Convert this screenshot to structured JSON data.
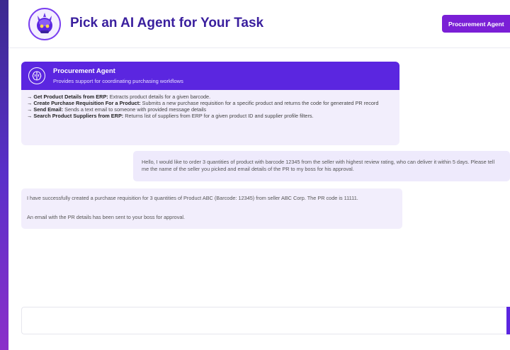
{
  "header": {
    "title": "Pick an AI Agent for Your Task",
    "agent_button_label": "Procurement Agent"
  },
  "agent_card": {
    "name": "Procurement Agent",
    "description": "Provides support for coordinating purchasing workflows",
    "tools": [
      {
        "name": "→ Get Product Details from ERP:",
        "desc": " Extracts product details for a given barcode."
      },
      {
        "name": "→ Create Purchase Requisition For a Product:",
        "desc": " Submits a new purchase requisition for a specific product and returns the code for generated PR record"
      },
      {
        "name": "→ Send Email:",
        "desc": " Sends a text email to someone with provided message details"
      },
      {
        "name": "→ Search Product Suppliers from ERP:",
        "desc": " Returns list of suppliers from ERP for a given product ID and supplier profile filters."
      }
    ]
  },
  "chat": {
    "user_message": "Hello, I would like to order 3 quantities of product with barcode 12345 from the seller with highest review rating, who can deliver it within 5 days. Please tell me the name of the seller you picked and email details of the PR to my boss for his approval.",
    "bot_message_1": "I have successfully created a purchase requisition for 3 quantities of Product ABC (Barcode: 12345) from seller ABC Corp. The PR code is 11111.",
    "bot_message_2": "An email with the PR details has been sent to your boss for approval."
  },
  "input": {
    "placeholder": ""
  },
  "colors": {
    "brand": "#3a1f9e",
    "accent": "#5b26e0",
    "button": "#7a1fd6"
  }
}
